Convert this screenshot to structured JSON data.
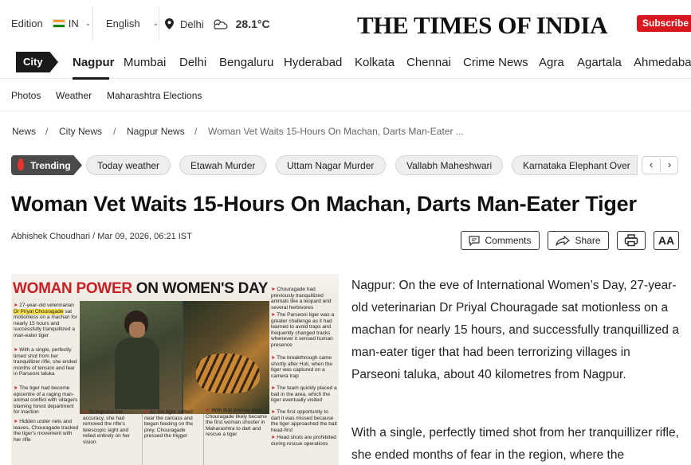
{
  "topbar": {
    "edition_label": "Edition",
    "edition_value": "IN",
    "language": "English",
    "city": "Delhi",
    "temperature": "28.1°C",
    "logo": "THE TIMES OF INDIA",
    "subscribe_label": "Subscribe T"
  },
  "city_nav": {
    "tag": "City",
    "items": [
      "Nagpur",
      "Mumbai",
      "Delhi",
      "Bengaluru",
      "Hyderabad",
      "Kolkata",
      "Chennai",
      "Crime News",
      "Agra",
      "Agartala",
      "Ahmedabad"
    ]
  },
  "sub_nav": {
    "items": [
      "Photos",
      "Weather",
      "Maharashtra Elections"
    ]
  },
  "breadcrumb": {
    "items": [
      "News",
      "City News",
      "Nagpur News",
      "Woman Vet Waits 15-Hours On Machan, Darts Man-Eater ..."
    ],
    "separator": "/"
  },
  "trending": {
    "label": "Trending",
    "pills": [
      "Today weather",
      "Etawah Murder",
      "Uttam Nagar Murder",
      "Vallabh Maheshwari",
      "Karnataka Elephant Over"
    ]
  },
  "article": {
    "headline": "Woman Vet Waits 15-Hours On Machan, Darts Man-Eater Tiger",
    "byline": "Abhishek Choudhari / Mar 09, 2026, 06:21 IST",
    "comments_label": "Comments",
    "share_label": "Share",
    "font_label": "AA",
    "para1": "Nagpur: On the eve of International Women’s Day, 27-year-old veterinarian Dr Priyal Chouragade sat motionless on a machan for nearly 15 hours, and successfully tranquillized a man-eater tiger that had been terrorizing villages in Parseoni taluka, about 40 kilometres from Nagpur.",
    "para2": "With a single, perfectly timed shot from her tranquillizer rifle, she ended months of fear in the region, where the"
  },
  "hero_image": {
    "title_red": "WOMAN POWER",
    "title_black": " ON WOMEN'S DAY",
    "left_caps": [
      "27-year-old veterinarian",
      "Dr Priyal Chouragade",
      "sat motionless on a machan for nearly 15 hours and successfully tranquillized a man-eater tiger",
      "With a single, perfectly timed shot from her tranquillizer rifle, she ended months of tension and fear in Parseoni taluka",
      "The tiger had become epicentre of a raging man-animal conflict with villagers blaming forest department for inaction",
      "Hidden under nets and leaves, Chouragade tracked the tiger's movement with her rifle"
    ],
    "bottom_caps": [
      "To improve her accuracy, she had removed the rifle's telescopic sight and relied entirely on her vision",
      "As the tiger settled near the carcass and began feeding on the prey, Chouragade pressed the trigger",
      "With that precise shot, Chouragade likely became the first woman shooter in Maharashtra to dart and rescue a tiger"
    ],
    "right_caps": [
      "Chouragade had previously tranquillized animals like a leopard and several herbivores",
      "The Parseoni tiger was a greater challenge as it had learned to avoid traps and frequently changed tracks whenever it sensed human presence",
      "The breakthrough came shortly after Holi, when the tiger was captured on a camera trap",
      "The team quickly placed a bait in the area, which the tiger eventually visited",
      "The first opportunity to dart it was missed because the tiger approached the bait head-first",
      "Head shots are prohibited during rescue operations"
    ]
  },
  "colors": {
    "accent_red": "#d7191f",
    "dark": "#1a1a1a",
    "pill_bg": "#eeeeee"
  }
}
